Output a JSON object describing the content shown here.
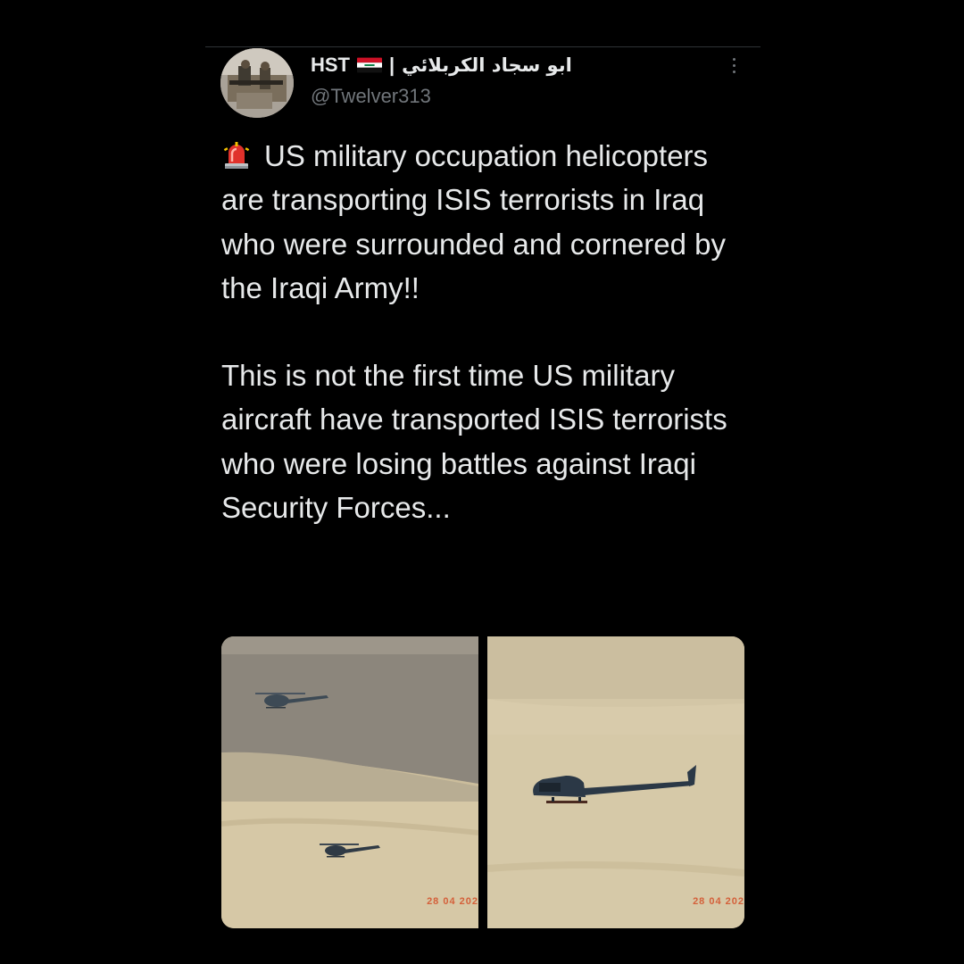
{
  "tweet": {
    "author": {
      "display_name": "HST",
      "flag": "iraq-flag-icon",
      "separator": "|",
      "arabic_name": "ابو سجاد الكربلائي",
      "handle": "@Twelver313"
    },
    "more_icon": "more-options-icon",
    "text_icon": "police-siren-icon",
    "paragraphs": [
      "US military occupation helicopters are transporting ISIS terrorists in Iraq who were surrounded and cornered by the Iraqi Army!!",
      "This is not the first time US military aircraft have transported ISIS terrorists who were losing battles against Iraqi Security Forces..."
    ],
    "media": [
      {
        "date_stamp": "28 04 202"
      },
      {
        "date_stamp": "28 04 202"
      }
    ]
  },
  "colors": {
    "background": "#000000",
    "text": "#e7e9ea",
    "secondary_text": "#71767b",
    "date_stamp": "#d4603a"
  }
}
